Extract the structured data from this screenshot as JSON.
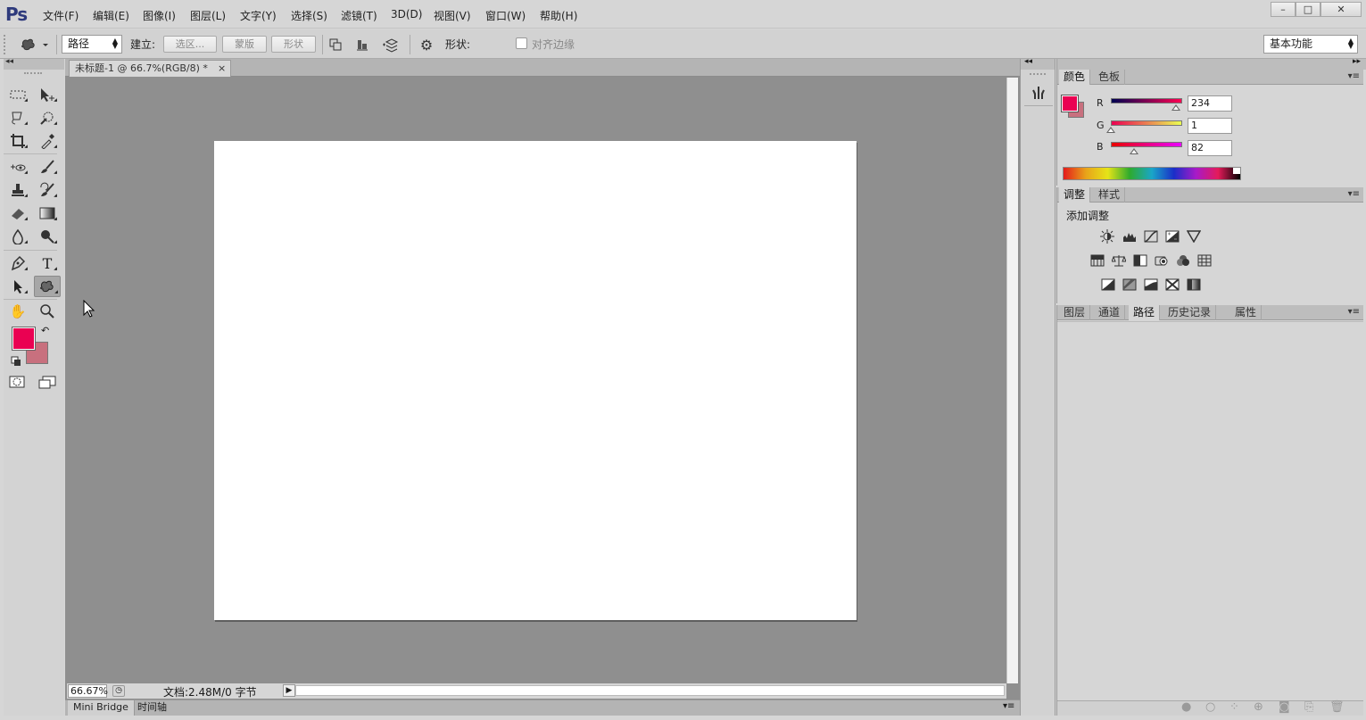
{
  "app": {
    "logo": "Ps"
  },
  "menu": [
    "文件(F)",
    "编辑(E)",
    "图像(I)",
    "图层(L)",
    "文字(Y)",
    "选择(S)",
    "滤镜(T)",
    "3D(D)",
    "视图(V)",
    "窗口(W)",
    "帮助(H)"
  ],
  "window_controls": {
    "minimize": "–",
    "maximize": "□",
    "close": "✕"
  },
  "options": {
    "mode_value": "路径",
    "build_label": "建立:",
    "selection_btn": "选区...",
    "mask_btn": "蒙版",
    "shape_btn": "形状",
    "shape_label": "形状:",
    "align_edges_label": "对齐边缘",
    "align_edges_checked": false,
    "workspace_value": "基本功能"
  },
  "document": {
    "tab_title": "未标题-1 @ 66.7%(RGB/8) *",
    "tab_close": "×",
    "zoom": "66.67%",
    "doc_info": "文档:2.48M/0 字节"
  },
  "bottom_tabs": [
    "Mini Bridge",
    "时间轴"
  ],
  "colors": {
    "foreground": "#ea0152",
    "background": "#c8707e",
    "canvas": "#ffffff"
  },
  "color_panel": {
    "tabs": [
      "颜色",
      "色板"
    ],
    "active_tab": "颜色",
    "channels": [
      {
        "label": "R",
        "value": "234"
      },
      {
        "label": "G",
        "value": "1"
      },
      {
        "label": "B",
        "value": "82"
      }
    ]
  },
  "adjust_panel": {
    "tabs": [
      "调整",
      "样式"
    ],
    "active_tab": "调整",
    "title": "添加调整",
    "icons_row1": [
      "brightness-contrast-icon",
      "levels-icon",
      "curves-icon",
      "exposure-icon",
      "vibrance-icon"
    ],
    "icons_row2": [
      "hue-saturation-icon",
      "color-balance-icon",
      "black-white-icon",
      "photo-filter-icon",
      "channel-mixer-icon",
      "color-lookup-icon"
    ],
    "icons_row3": [
      "invert-icon",
      "posterize-icon",
      "threshold-icon",
      "selective-color-icon",
      "gradient-map-icon"
    ]
  },
  "layers_panel": {
    "tabs": [
      "图层",
      "通道",
      "路径",
      "历史记录",
      "属性"
    ],
    "active_tab": "路径"
  }
}
